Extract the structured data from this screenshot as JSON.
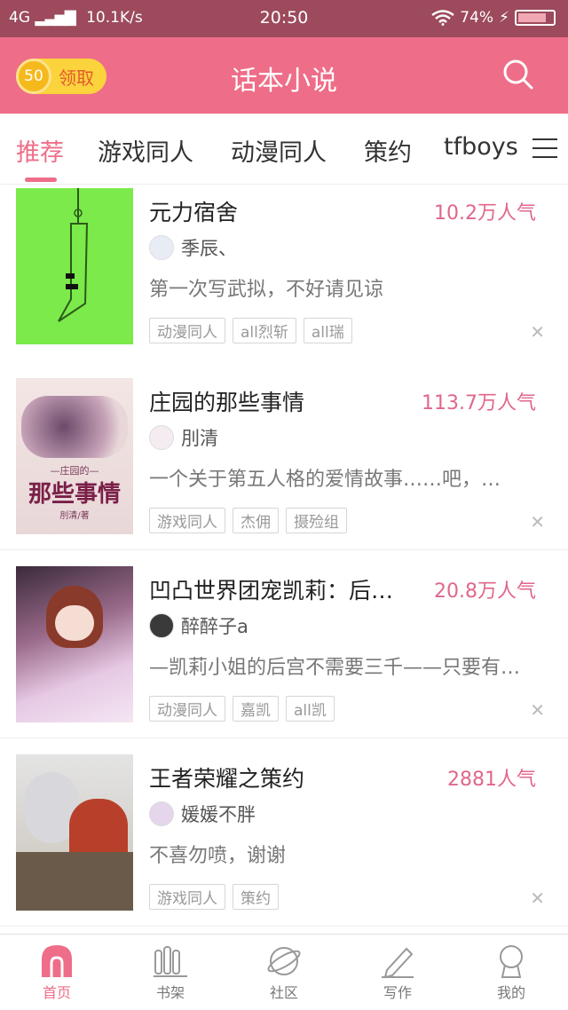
{
  "status_bar": {
    "network": "4G",
    "speed": "10.1K/s",
    "time": "20:50",
    "battery": "74%"
  },
  "header": {
    "coin_count": "50",
    "coin_label": "领取",
    "title": "话本小说",
    "accent_color": "#ee6d88"
  },
  "tabs": [
    {
      "label": "推荐",
      "active": true
    },
    {
      "label": "游戏同人"
    },
    {
      "label": "动漫同人"
    },
    {
      "label": "策约"
    },
    {
      "label": "tfboys"
    }
  ],
  "feed": [
    {
      "title": "元力宿舍",
      "popularity": "10.2万人气",
      "author": "季辰、",
      "description": "第一次写武拟，不好请见谅",
      "tags": [
        "动漫同人",
        "all烈斩",
        "all瑞"
      ],
      "cover_color": "#7bea4a"
    },
    {
      "title": "庄园的那些事情",
      "popularity": "113.7万人气",
      "author": "刖清",
      "description": "一个关于第五人格的爱情故事……吧，…",
      "tags": [
        "游戏同人",
        "杰佣",
        "摄殓组"
      ],
      "cover_text_small": "—庄园的—",
      "cover_text_big": "那些事情",
      "cover_text_author": "刖清/著"
    },
    {
      "title": "凹凸世界团宠凯莉：后…",
      "popularity": "20.8万人气",
      "author": "醉醉子a",
      "description": "—凯莉小姐的后宫不需要三千——只要有…",
      "tags": [
        "动漫同人",
        "嘉凯",
        "all凯"
      ]
    },
    {
      "title": "王者荣耀之策约",
      "popularity": "2881人气",
      "author": "媛媛不胖",
      "description": "不喜勿喷，谢谢",
      "tags": [
        "游戏同人",
        "策约"
      ]
    }
  ],
  "bottom_nav": [
    {
      "label": "首页",
      "icon": "home-icon",
      "active": true
    },
    {
      "label": "书架",
      "icon": "bookshelf-icon"
    },
    {
      "label": "社区",
      "icon": "planet-icon"
    },
    {
      "label": "写作",
      "icon": "pencil-icon"
    },
    {
      "label": "我的",
      "icon": "profile-icon"
    }
  ]
}
